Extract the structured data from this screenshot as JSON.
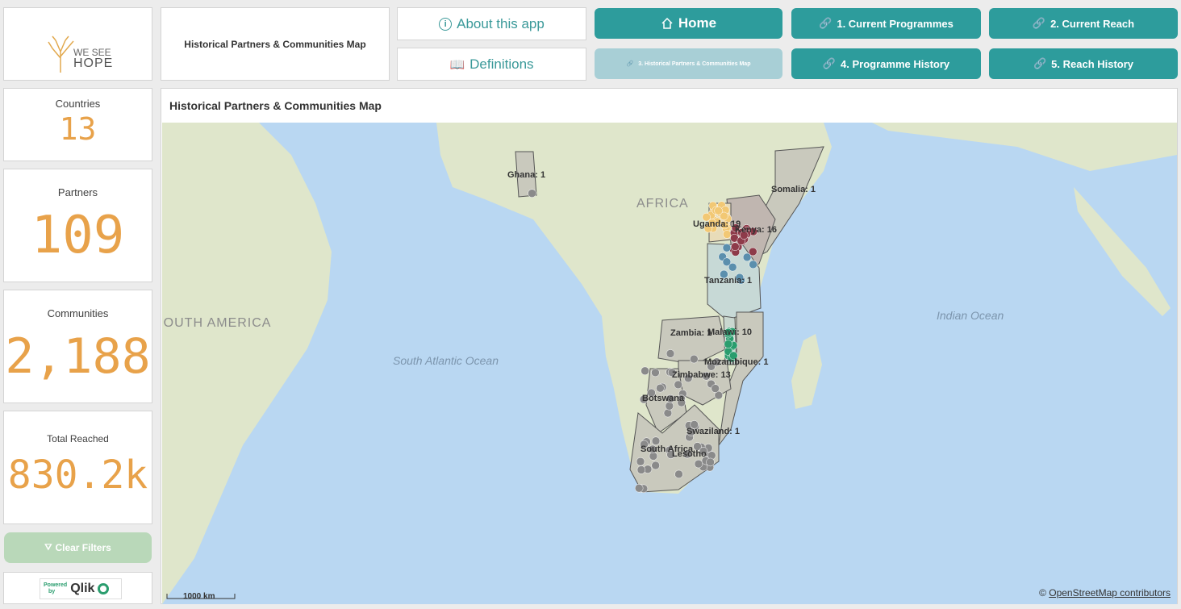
{
  "app": {
    "logo_text_top": "WE SEE",
    "logo_text_bottom": "HOPE",
    "sheet_title": "Historical Partners & Communities Map"
  },
  "info_buttons": {
    "about": "About this app",
    "definitions": "Definitions"
  },
  "nav": {
    "home": "Home",
    "current_programmes": "1. Current Programmes",
    "current_reach": "2. Current Reach",
    "historical_map": "3. Historical Partners & Communities Map",
    "programme_history": "4. Programme History",
    "reach_history": "5. Reach History"
  },
  "kpis": {
    "countries_label": "Countries",
    "countries_value": "13",
    "partners_label": "Partners",
    "partners_value": "109",
    "communities_label": "Communities",
    "communities_value": "2,188",
    "reached_label": "Total Reached",
    "reached_value": "830.2k"
  },
  "clear_filters": "Clear Filters",
  "powered_by": {
    "line1": "Powered",
    "line2": "by",
    "brand": "Qlik"
  },
  "map": {
    "title": "Historical Partners & Communities Map",
    "scale": "1000 km",
    "attribution_prefix": "©",
    "attribution_link": "OpenStreetMap contributors",
    "ocean_labels": [
      "South Atlantic Ocean",
      "Indian Ocean"
    ],
    "continent_labels": [
      "AFRICA",
      "SOUTH AMERICA"
    ],
    "country_labels": [
      "Ghana: 1",
      "Somalia: 1",
      "Uganda: 19",
      "Kenya: 16",
      "Tanzania: 1",
      "Zambia: 1",
      "Malawi: 10",
      "Mozambique: 1",
      "Zimbabwe: 13",
      "Botswana",
      "Swaziland: 1",
      "South Africa",
      "Lesotho"
    ],
    "colors": {
      "uganda": "#f2c874",
      "kenya": "#8e3b4a",
      "tanzania": "#5b8fad",
      "malawi": "#2a9d6e",
      "other": "#8a8a8a"
    }
  }
}
